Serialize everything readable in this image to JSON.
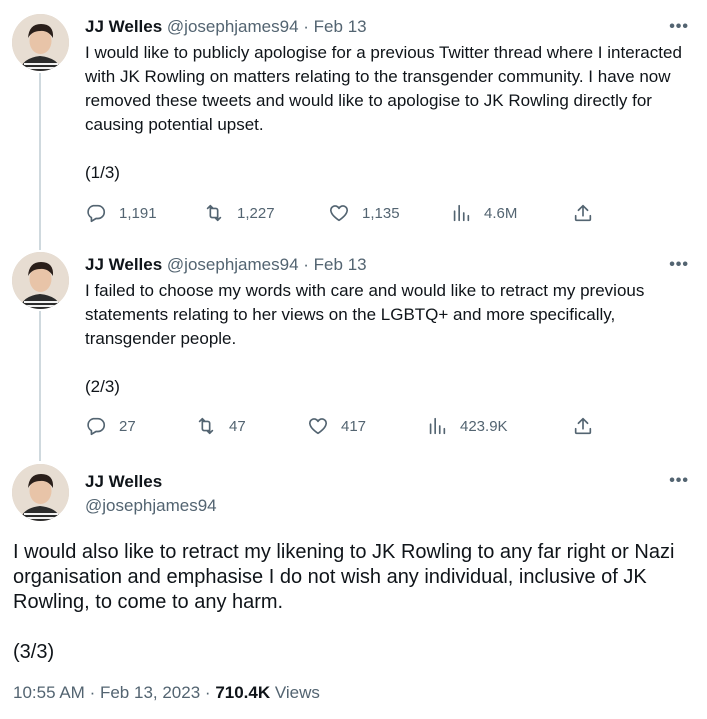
{
  "tweets": [
    {
      "name": "JJ Welles",
      "handle": "@josephjames94",
      "separator": "·",
      "date": "Feb 13",
      "text": "I would like to publicly apologise for a previous Twitter thread where I interacted with JK Rowling on matters relating to the transgender community. I have now removed these tweets and would like to apologise to JK Rowling directly for causing potential upset.",
      "counter": "(1/3)",
      "replies": "1,191",
      "retweets": "1,227",
      "likes": "1,135",
      "views": "4.6M"
    },
    {
      "name": "JJ Welles",
      "handle": "@josephjames94",
      "separator": "·",
      "date": "Feb 13",
      "text": "I failed to choose my words with care and would like to retract my previous statements relating to her views on the LGBTQ+ and more specifically, transgender people.",
      "counter": "(2/3)",
      "replies": "27",
      "retweets": "47",
      "likes": "417",
      "views": "423.9K"
    },
    {
      "name": "JJ Welles",
      "handle": "@josephjames94",
      "text": "I would also like to retract my likening to JK Rowling to any far right or Nazi organisation and emphasise I do not wish any individual, inclusive of JK Rowling, to come to any harm.",
      "counter": "(3/3)",
      "time": "10:55 AM",
      "separator": "·",
      "full_date": "Feb 13, 2023",
      "views_count": "710.4K",
      "views_label": "Views"
    }
  ],
  "more_label": "•••",
  "colors": {
    "text": "#0f1419",
    "secondary": "#536471",
    "thread_line": "#cfd9de"
  }
}
